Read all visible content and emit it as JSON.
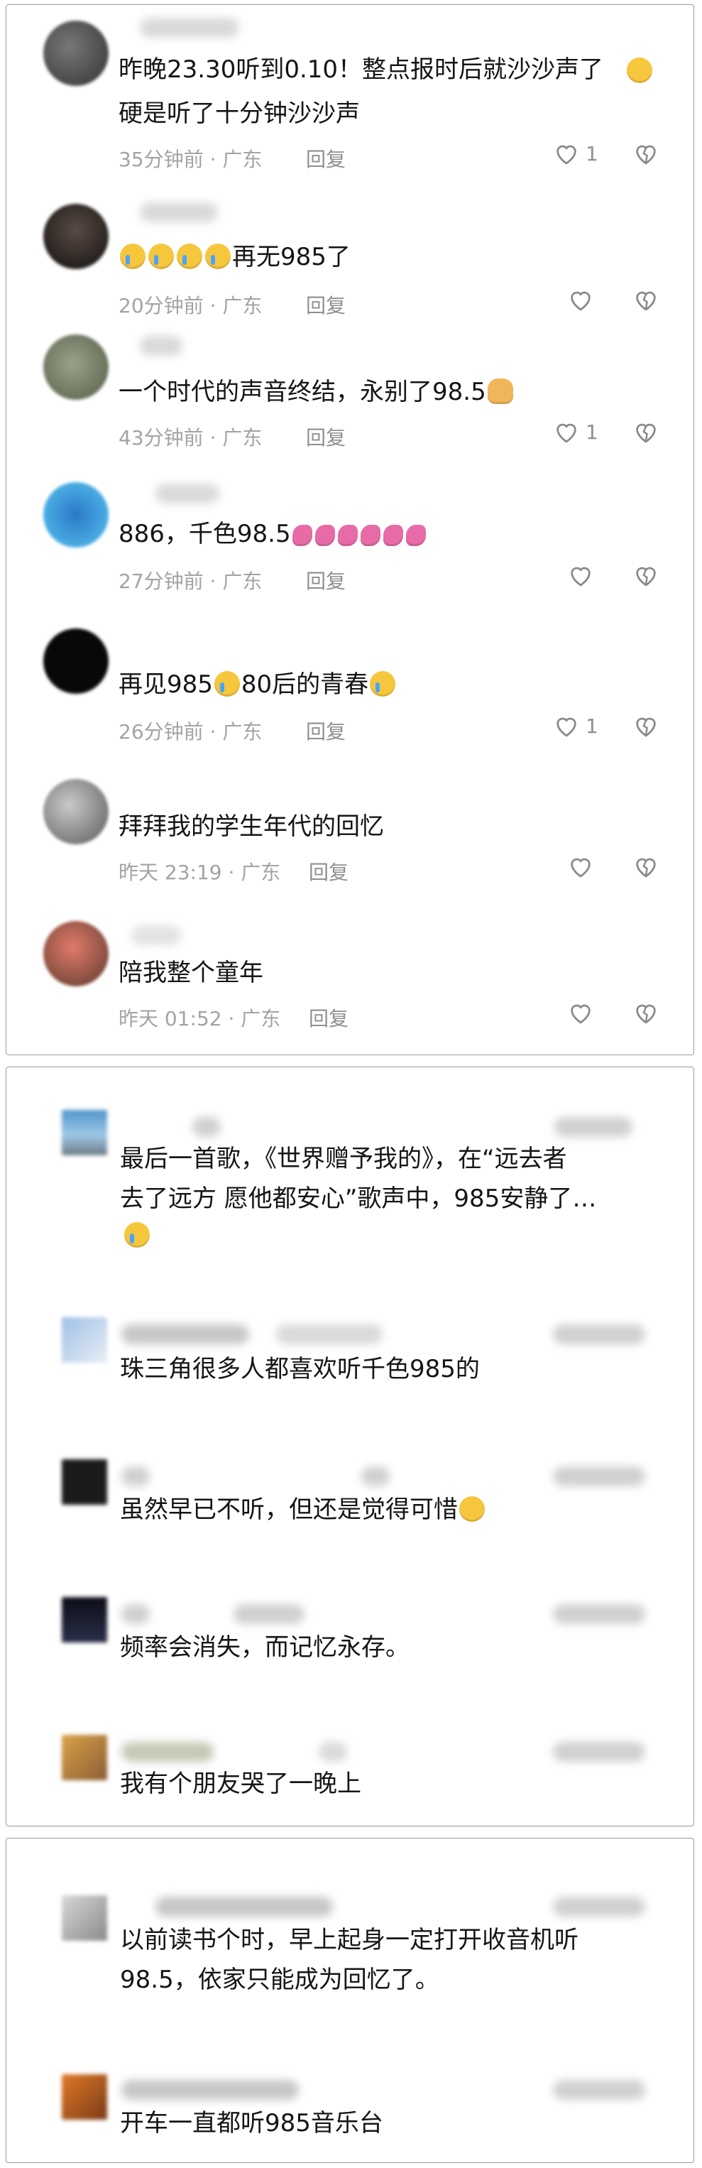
{
  "panel1": {
    "comments": [
      {
        "text_line1": "昨晚23.30听到0.10！整点报时后就沙沙声了",
        "text_line2": "硬是听了十分钟沙沙声",
        "time": "35分钟前 · 广东",
        "reply": "回复",
        "likes": "1"
      },
      {
        "text": "再无985了",
        "time": "20分钟前 · 广东",
        "reply": "回复",
        "likes": ""
      },
      {
        "text": "一个时代的声音终结，永别了98.5",
        "time": "43分钟前 · 广东",
        "reply": "回复",
        "likes": "1"
      },
      {
        "text": "886，千色98.5",
        "time": "27分钟前 · 广东",
        "reply": "回复",
        "likes": ""
      },
      {
        "text_a": "再见985",
        "text_b": "80后的青春",
        "time": "26分钟前 · 广东",
        "reply": "回复",
        "likes": "1"
      },
      {
        "text": "拜拜我的学生年代的回忆",
        "time": "昨天 23:19 · 广东",
        "reply": "回复",
        "likes": ""
      },
      {
        "text": "陪我整个童年",
        "time": "昨天 01:52 · 广东",
        "reply": "回复",
        "likes": ""
      }
    ]
  },
  "panel2": {
    "comments": [
      {
        "line1": "最后一首歌，《世界赠予我的》，在“远去者",
        "line2": "去了远方 愿他都安心”歌声中，985安静了…"
      },
      {
        "line1": "珠三角很多人都喜欢听千色985的"
      },
      {
        "line1": "虽然早已不听，但还是觉得可惜"
      },
      {
        "line1": "频率会消失，而记忆永存。"
      },
      {
        "line1": "我有个朋友哭了一晚上"
      }
    ]
  },
  "panel3": {
    "comments": [
      {
        "line1": "以前读书个时，早上起身一定打开收音机听",
        "line2": "98.5，依家只能成为回忆了。"
      },
      {
        "line1": "开车一直都听985音乐台"
      }
    ]
  },
  "colors": {
    "meta": "#a3a3a3",
    "border": "#9a9a9a",
    "text": "#151515"
  }
}
